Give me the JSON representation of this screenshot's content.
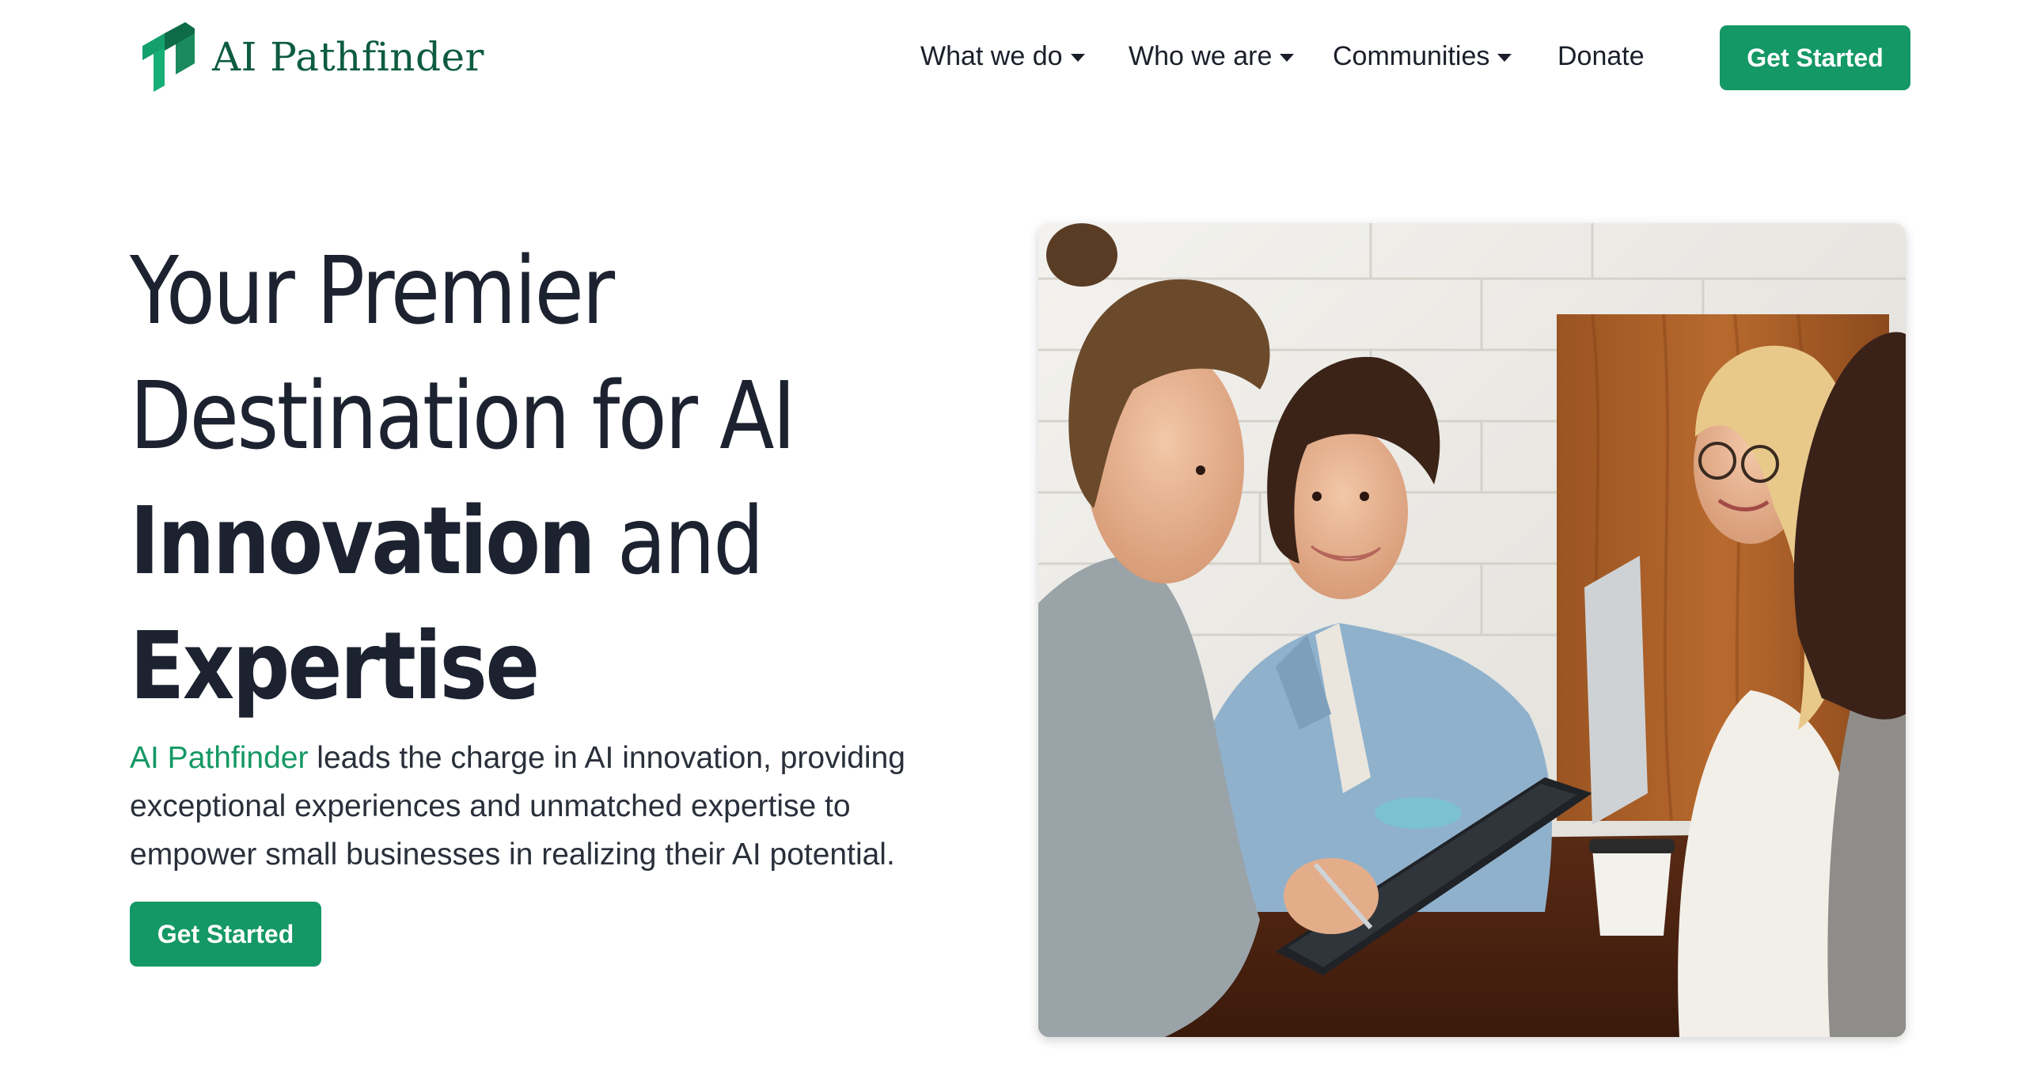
{
  "header": {
    "brand_name": "AI Pathfinder",
    "logo_icon": "ai-pathfinder-logo-icon",
    "nav": [
      {
        "label": "What we do",
        "dropdown": true
      },
      {
        "label": "Who we are",
        "dropdown": true
      },
      {
        "label": "Communities",
        "dropdown": true
      },
      {
        "label": "Donate",
        "dropdown": false
      }
    ],
    "cta_label": "Get Started"
  },
  "hero": {
    "title_line1": "Your Premier",
    "title_line2": "Destination for AI",
    "title_line3_bold": "Innovation",
    "title_line3_rest": " and",
    "title_line4_bold": "Expertise",
    "description_highlight": "AI Pathfinder",
    "description_rest": " leads the charge in AI innovation, providing exceptional experiences and unmatched expertise to empower small businesses in realizing their AI potential.",
    "cta_label": "Get Started",
    "image_subject": "team-collaboration-photo"
  },
  "colors": {
    "accent": "#149865",
    "brand_text": "#0d5c3f",
    "text": "#1c2230"
  }
}
